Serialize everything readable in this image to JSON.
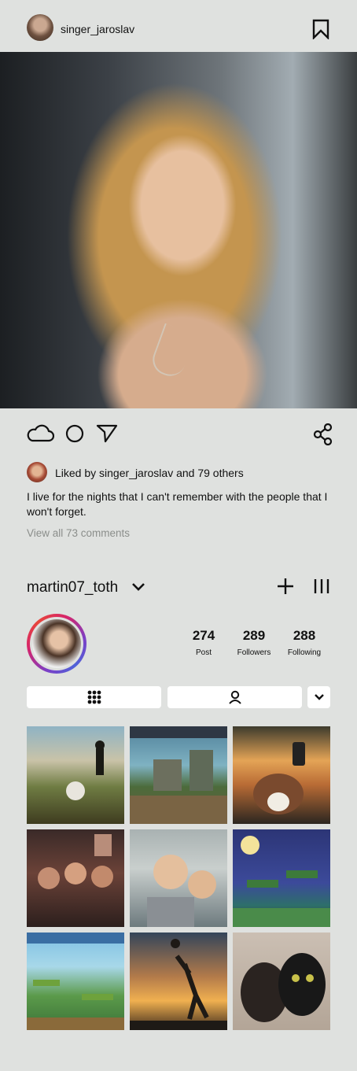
{
  "post": {
    "username": "singer_jaroslav",
    "liked_by_text": "Liked by singer_jaroslav and 79 others",
    "caption": "I live for the nights that I can't remember with the people that I won't forget.",
    "view_comments": "View all 73 comments"
  },
  "profile": {
    "username": "martin07_toth",
    "stats": [
      {
        "value": "274",
        "label": "Post"
      },
      {
        "value": "289",
        "label": "Followers"
      },
      {
        "value": "288",
        "label": "Following"
      }
    ]
  },
  "icons": {
    "bookmark": "bookmark-icon",
    "like": "cloud-like-icon",
    "comment": "circle-comment-icon",
    "share": "send-icon",
    "network_share": "share-nodes-icon",
    "dropdown": "chevron-down-icon",
    "add": "plus-icon",
    "menu": "menu-bars-icon",
    "grid_tab": "grid-icon",
    "tagged_tab": "person-icon"
  },
  "grid": [
    {
      "subject": "soccer player silhouette at sunset"
    },
    {
      "subject": "pixel art jungle temple"
    },
    {
      "subject": "dog selfie in car at sunset"
    },
    {
      "subject": "friends at a party"
    },
    {
      "subject": "two smiling boys"
    },
    {
      "subject": "pixel art platformer at night"
    },
    {
      "subject": "mobile game jungle level"
    },
    {
      "subject": "basketball silhouette at sunset"
    },
    {
      "subject": "two black dogs"
    }
  ],
  "colors": {
    "background": "#dfe1df",
    "muted_text": "#8b8e8b",
    "ring_start": "#7b3fc7",
    "ring_end": "#d6246a"
  }
}
